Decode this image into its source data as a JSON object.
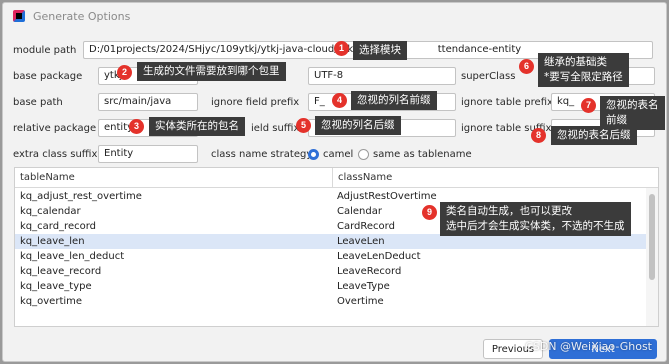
{
  "window": {
    "title": "Generate Options"
  },
  "form": {
    "module_path": {
      "label": "module path",
      "value": "D:/01projects/2024/SHjyc/109ytkj/ytkj-java-cloud/ytkj-a",
      "value_tail": "ttendance-entity"
    },
    "base_package": {
      "label": "base package",
      "value": "ytkj"
    },
    "encoding": {
      "value": "UTF-8"
    },
    "super_class": {
      "label": "superClass",
      "value": ""
    },
    "base_path": {
      "label": "base path",
      "value": "src/main/java"
    },
    "ignore_field_prefix": {
      "label": "ignore field prefix",
      "value": "F_"
    },
    "ignore_table_prefix": {
      "label": "ignore table prefix",
      "value": "kq_"
    },
    "relative_package": {
      "label": "relative package",
      "value": "entity"
    },
    "ignore_field_suffix": {
      "label": "ield suffix",
      "value": ""
    },
    "ignore_table_suffix": {
      "label": "ignore table suffix",
      "value": ""
    },
    "extra_class_suffix": {
      "label": "extra class suffix",
      "value": "Entity"
    },
    "class_name_strategy": {
      "label": "class name strategy",
      "options": [
        "camel",
        "same as tablename"
      ],
      "selected": "camel"
    }
  },
  "table": {
    "headers": [
      "tableName",
      "className"
    ],
    "rows": [
      [
        "kq_adjust_rest_overtime",
        "AdjustRestOvertime"
      ],
      [
        "kq_calendar",
        "Calendar"
      ],
      [
        "kq_card_record",
        "CardRecord"
      ],
      [
        "kq_leave_len",
        "LeaveLen"
      ],
      [
        "kq_leave_len_deduct",
        "LeaveLenDeduct"
      ],
      [
        "kq_leave_record",
        "LeaveRecord"
      ],
      [
        "kq_leave_type",
        "LeaveType"
      ],
      [
        "kq_overtime",
        "Overtime"
      ]
    ],
    "selected_row": 3
  },
  "buttons": {
    "cancel": "Previous",
    "next": "Next"
  },
  "annotations": [
    {
      "num": "1",
      "text": "选择模块"
    },
    {
      "num": "2",
      "text": "生成的文件需要放到哪个包里"
    },
    {
      "num": "3",
      "text": "实体类所在的包名"
    },
    {
      "num": "4",
      "text": "忽视的列名前缀"
    },
    {
      "num": "5",
      "text": "忽视的列名后缀"
    },
    {
      "num": "6",
      "text": "继承的基础类",
      "text2": "*要写全限定路径"
    },
    {
      "num": "7",
      "text": "忽视的表名",
      "text2": "前缀"
    },
    {
      "num": "8",
      "text": "忽视的表名后缀"
    },
    {
      "num": "9",
      "text": "类名自动生成，也可以更改",
      "text2": "选中后才会生成实体类，不选的不生成"
    }
  ],
  "watermark": "CSDN @WeiXiao-Ghost"
}
